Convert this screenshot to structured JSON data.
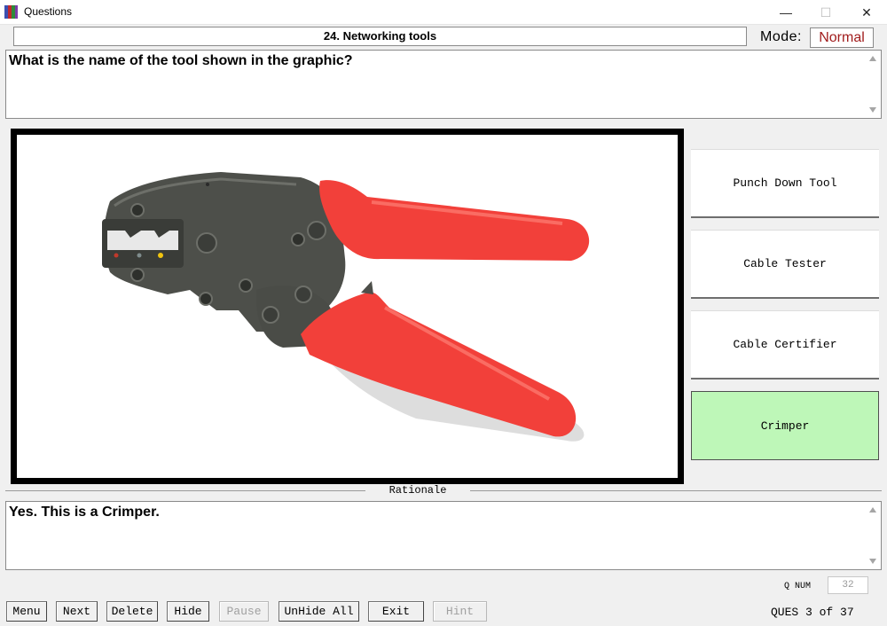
{
  "window": {
    "title": "Questions",
    "minimize_glyph": "—",
    "maximize_glyph": "☐",
    "close_glyph": "✕"
  },
  "header": {
    "topic": "24. Networking tools",
    "mode_label": "Mode:",
    "mode_value": "Normal"
  },
  "question": {
    "text": "What is the name of the tool shown in the graphic?"
  },
  "answers": [
    {
      "label": "Punch Down Tool",
      "selected": false
    },
    {
      "label": "Cable Tester",
      "selected": false
    },
    {
      "label": "Cable Certifier",
      "selected": false
    },
    {
      "label": "Crimper",
      "selected": true
    }
  ],
  "rationale": {
    "label": "Rationale",
    "text": "Yes. This is a Crimper."
  },
  "footer": {
    "qnum_label": "Q NUM",
    "qnum_value": "32",
    "buttons": [
      {
        "label": "Menu",
        "enabled": true
      },
      {
        "label": "Next",
        "enabled": true
      },
      {
        "label": "Delete",
        "enabled": true
      },
      {
        "label": "Hide",
        "enabled": true
      },
      {
        "label": "Pause",
        "enabled": false
      },
      {
        "label": "UnHide All",
        "enabled": true
      },
      {
        "label": "Exit",
        "enabled": true
      },
      {
        "label": "Hint",
        "enabled": false
      }
    ],
    "status": "QUES 3 of 37"
  },
  "colors": {
    "mode_value": "#a11d1d",
    "selected_answer": "#bef7b8",
    "handle_red": "#f2403a",
    "tool_body": "#4d4f4a"
  },
  "image": {
    "subject": "crimper-tool-photo"
  }
}
